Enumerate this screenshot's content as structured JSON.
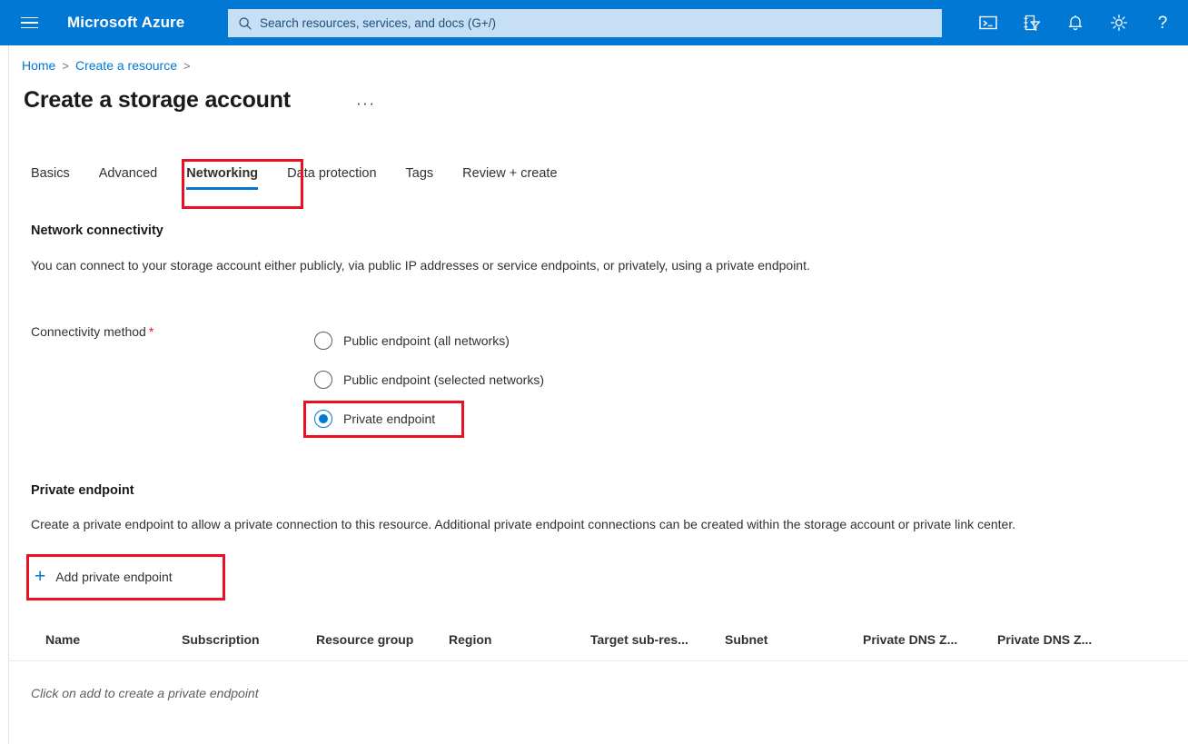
{
  "topbar": {
    "menu_icon": "hamburger-icon",
    "brand": "Microsoft Azure",
    "search": {
      "placeholder": "Search resources, services, and docs (G+/)",
      "value": "",
      "icon": "search-icon"
    },
    "icons": [
      {
        "name": "cloud-shell-icon",
        "title": "Cloud Shell"
      },
      {
        "name": "directory-filter-icon",
        "title": "Directories + subscriptions"
      },
      {
        "name": "notifications-bell-icon",
        "title": "Notifications"
      },
      {
        "name": "settings-gear-icon",
        "title": "Settings"
      },
      {
        "name": "help-question-icon",
        "title": "Help"
      }
    ]
  },
  "breadcrumb": {
    "items": [
      "Home",
      "Create a resource"
    ],
    "separator": ">"
  },
  "page": {
    "title": "Create a storage account",
    "more_actions": "···"
  },
  "tabs": [
    {
      "label": "Basics",
      "active": false
    },
    {
      "label": "Advanced",
      "active": false
    },
    {
      "label": "Networking",
      "active": true
    },
    {
      "label": "Data protection",
      "active": false
    },
    {
      "label": "Tags",
      "active": false
    },
    {
      "label": "Review + create",
      "active": false
    }
  ],
  "network_connectivity": {
    "heading": "Network connectivity",
    "description": "You can connect to your storage account either publicly, via public IP addresses or service endpoints, or privately, using a private endpoint.",
    "field_label": "Connectivity method",
    "required_marker": "*",
    "options": [
      {
        "label": "Public endpoint (all networks)",
        "selected": false
      },
      {
        "label": "Public endpoint (selected networks)",
        "selected": false
      },
      {
        "label": "Private endpoint",
        "selected": true
      }
    ]
  },
  "private_endpoint": {
    "heading": "Private endpoint",
    "description": "Create a private endpoint to allow a private connection to this resource. Additional private endpoint connections can be created within the storage account or private link center.",
    "add_button": {
      "label": "Add private endpoint",
      "icon": "plus-icon"
    },
    "table": {
      "columns": [
        "Name",
        "Subscription",
        "Resource group",
        "Region",
        "Target sub-res...",
        "Subnet",
        "Private DNS Z...",
        "Private DNS Z..."
      ],
      "rows": [],
      "empty_message": "Click on add to create a private endpoint"
    }
  },
  "annotations": {
    "highlight_color": "#e81123",
    "boxes": [
      "networking-tab",
      "private-endpoint-radio",
      "add-private-endpoint-button"
    ]
  },
  "colors": {
    "azure_blue": "#0078d4",
    "search_bg": "#c7dff5",
    "required_red": "#e81123"
  }
}
